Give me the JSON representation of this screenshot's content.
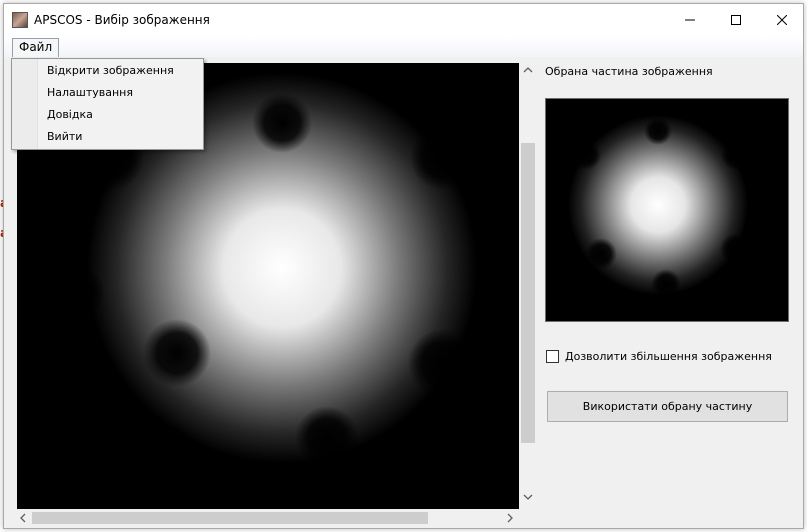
{
  "window": {
    "title": "APSCOS - Вибір зображення",
    "controls": [
      "minimize-icon",
      "maximize-icon",
      "close-icon"
    ]
  },
  "menubar": {
    "file_label": "Файл"
  },
  "file_menu": {
    "items": [
      {
        "label": "Відкрити зображення"
      },
      {
        "label": "Налаштування"
      },
      {
        "label": "Довідка"
      },
      {
        "label": "Вийти"
      }
    ]
  },
  "side_panel": {
    "selected_part_label": "Обрана частина зображення",
    "allow_zoom_label": "Дозволити збільшення зображення",
    "allow_zoom_checked": false,
    "use_button_label": "Використати обрану частину"
  },
  "colors": {
    "image_background": "#000000",
    "window_background": "#f0f0f0",
    "scrollbar_thumb": "#cdcdcd"
  }
}
